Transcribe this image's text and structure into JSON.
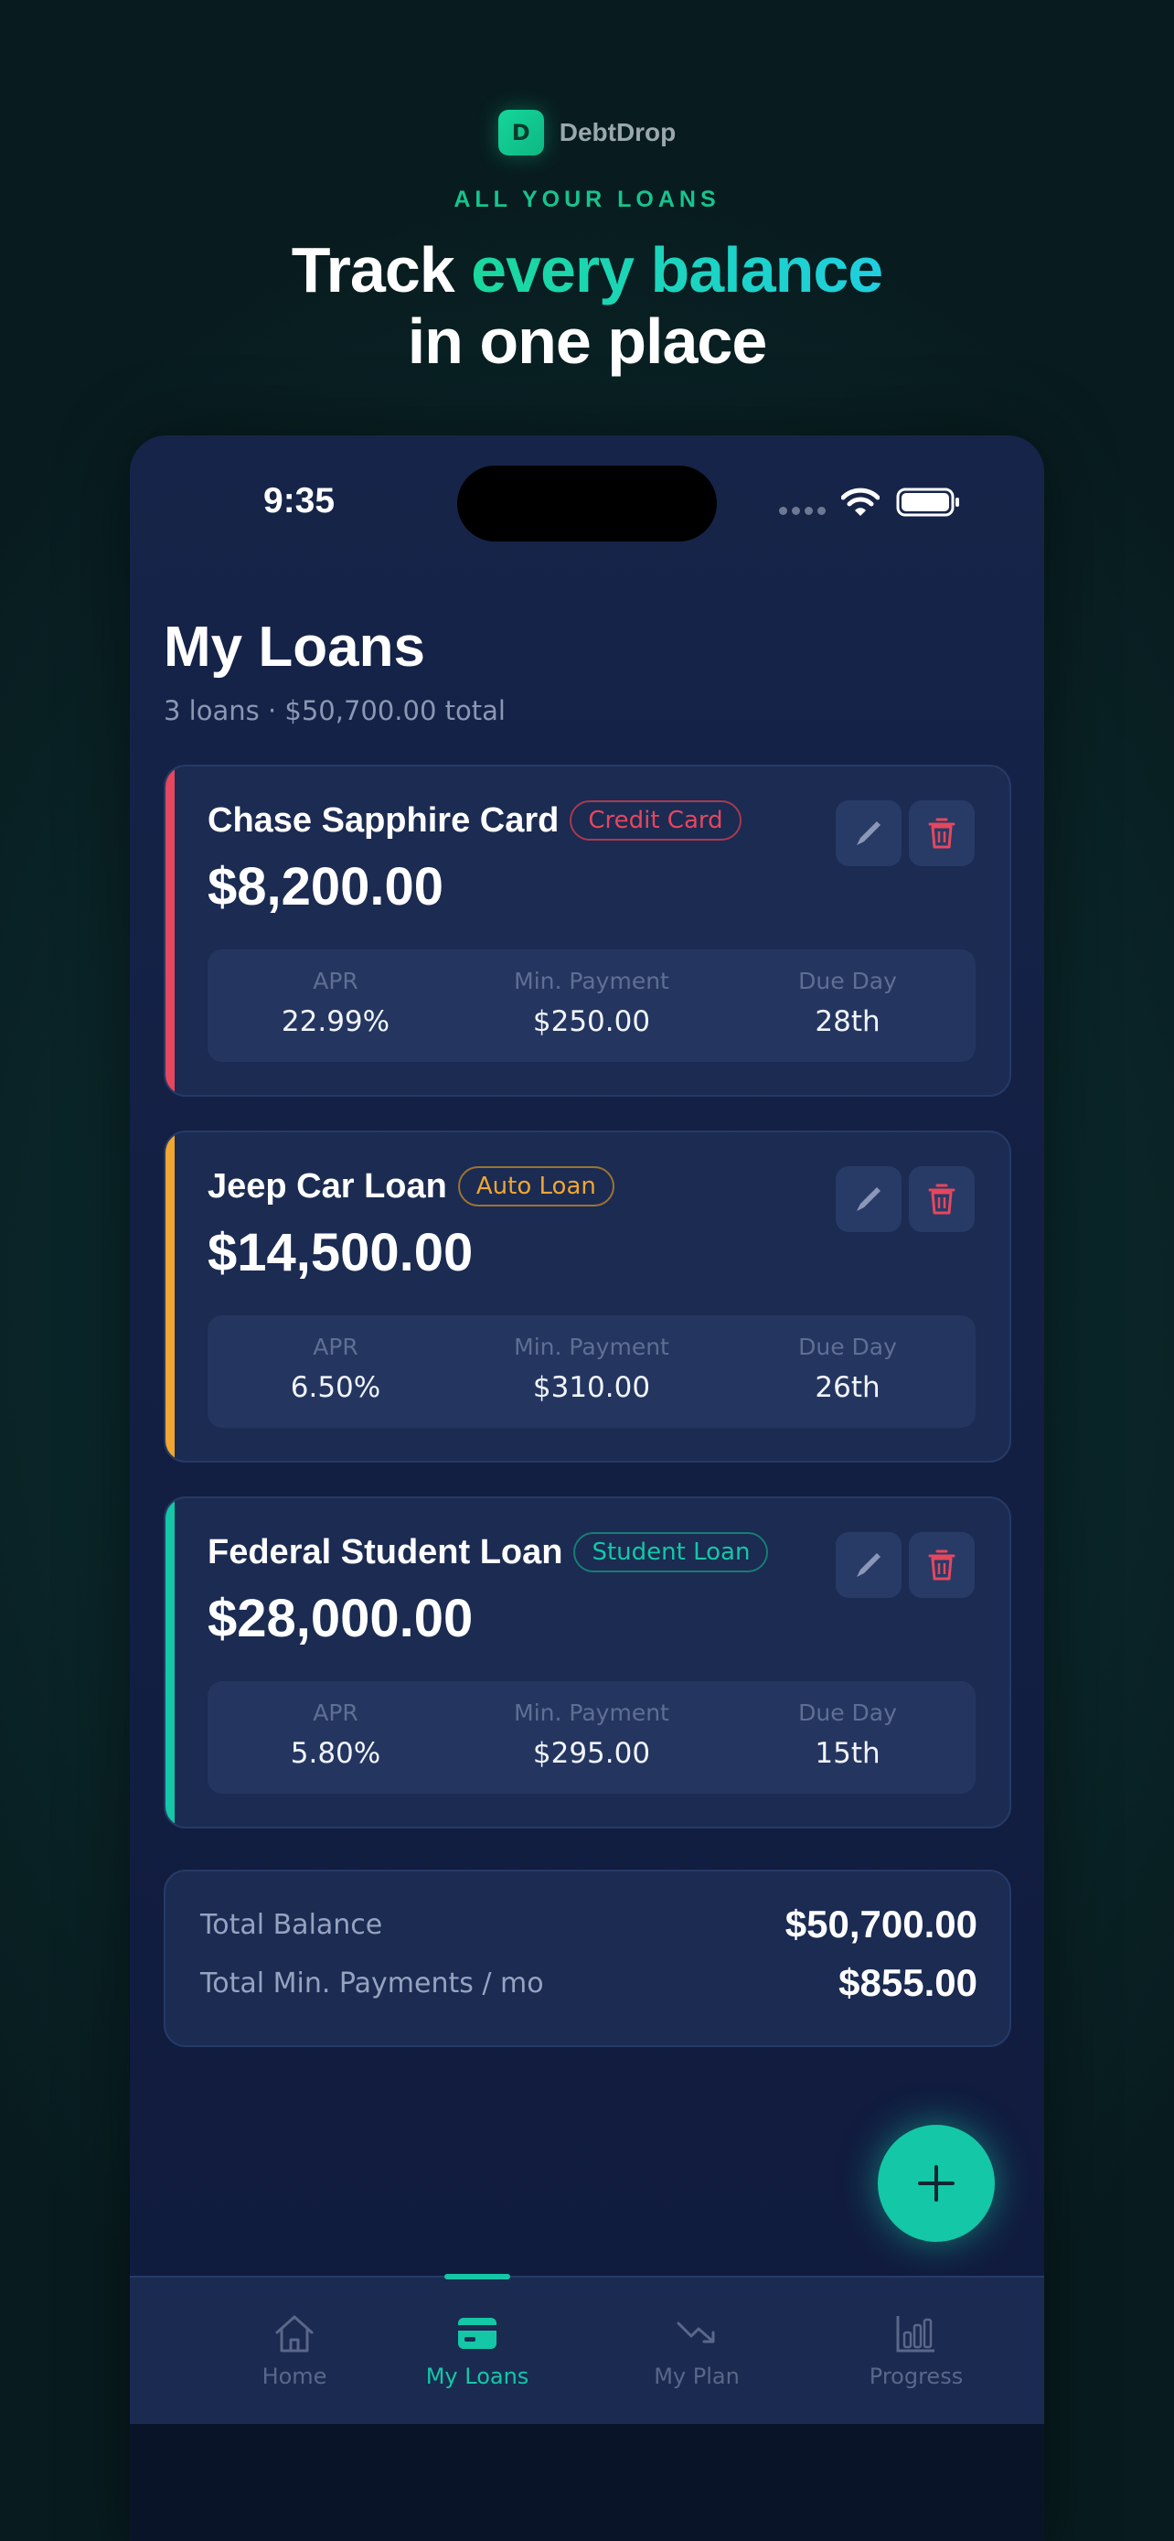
{
  "brand": {
    "logo_letter": "D",
    "name": "DebtDrop"
  },
  "hero": {
    "eyebrow": "ALL YOUR LOANS",
    "headline_start": "Track ",
    "headline_accent": "every balance",
    "headline_line2": "in one place"
  },
  "status_bar": {
    "time": "9:35"
  },
  "page": {
    "title": "My Loans",
    "subtitle": "3 loans · $50,700.00 total"
  },
  "stat_labels": {
    "apr": "APR",
    "min_payment": "Min. Payment",
    "due_day": "Due Day"
  },
  "loans": [
    {
      "name": "Chase Sapphire Card",
      "type": "Credit Card",
      "amount": "$8,200.00",
      "apr": "22.99%",
      "min_payment": "$250.00",
      "due_day": "28th",
      "color": "#e5475f"
    },
    {
      "name": "Jeep Car Loan",
      "type": "Auto Loan",
      "amount": "$14,500.00",
      "apr": "6.50%",
      "min_payment": "$310.00",
      "due_day": "26th",
      "color": "#f0a630"
    },
    {
      "name": "Federal Student Loan",
      "type": "Student Loan",
      "amount": "$28,000.00",
      "apr": "5.80%",
      "min_payment": "$295.00",
      "due_day": "15th",
      "color": "#14c7a6"
    }
  ],
  "totals": {
    "balance_label": "Total Balance",
    "balance_value": "$50,700.00",
    "min_label": "Total Min. Payments / mo",
    "min_value": "$855.00"
  },
  "tabs": [
    {
      "label": "Home",
      "icon": "home-icon",
      "active": false
    },
    {
      "label": "My Loans",
      "icon": "card-icon",
      "active": true
    },
    {
      "label": "My Plan",
      "icon": "trend-down-icon",
      "active": false
    },
    {
      "label": "Progress",
      "icon": "bar-chart-icon",
      "active": false
    }
  ],
  "colors": {
    "accent": "#14c7a6",
    "brand_green": "#14d69a",
    "credit": "#e5475f",
    "auto": "#f0a630",
    "student": "#14c7a6",
    "card_bg": "#1b2b52"
  }
}
